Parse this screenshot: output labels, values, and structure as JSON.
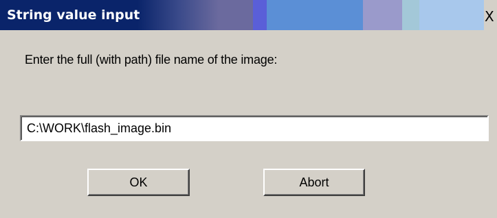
{
  "window": {
    "title": "String value input",
    "close_glyph": "X"
  },
  "dialog": {
    "prompt": "Enter the full (with path) file name of the image:",
    "input_value": "C:\\WORK\\flash_image.bin",
    "ok_label": "OK",
    "abort_label": "Abort"
  },
  "colors": {
    "face": "#d4d0c8",
    "title_text": "#ffffff",
    "input_bg": "#ffffff"
  }
}
